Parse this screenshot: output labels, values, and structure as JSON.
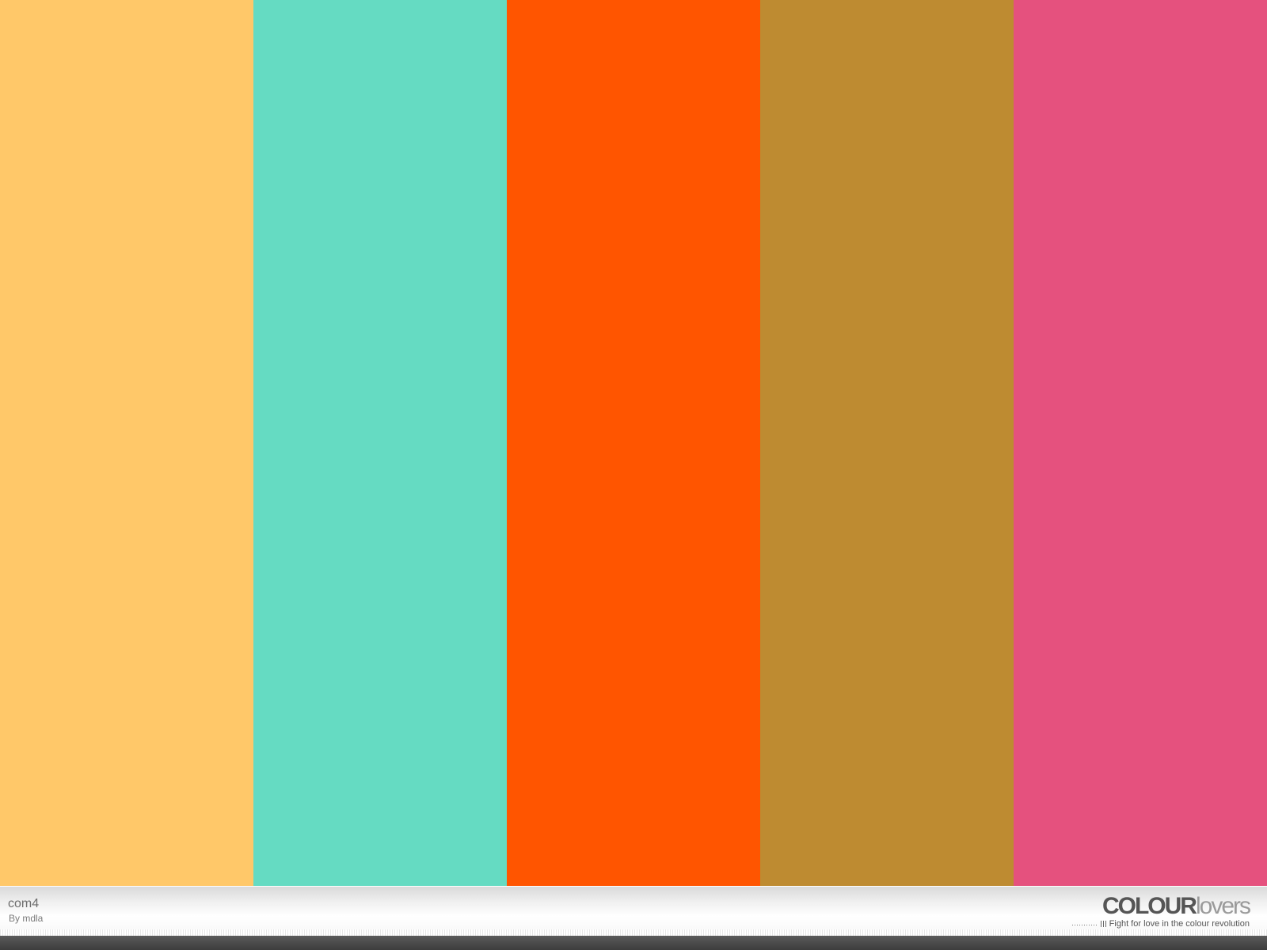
{
  "palette": {
    "title": "com4",
    "author": "By mdla",
    "colors": [
      {
        "name": "yellow-orange",
        "hex": "#FFC869"
      },
      {
        "name": "turquoise",
        "hex": "#65DBC2"
      },
      {
        "name": "orange-red",
        "hex": "#FF5500"
      },
      {
        "name": "ochre",
        "hex": "#BE8B31"
      },
      {
        "name": "pink",
        "hex": "#E5517E"
      }
    ]
  },
  "brand": {
    "logo_strong": "COLOUR",
    "logo_light": "lovers",
    "tagline": "Fight for love in the colour revolution"
  }
}
